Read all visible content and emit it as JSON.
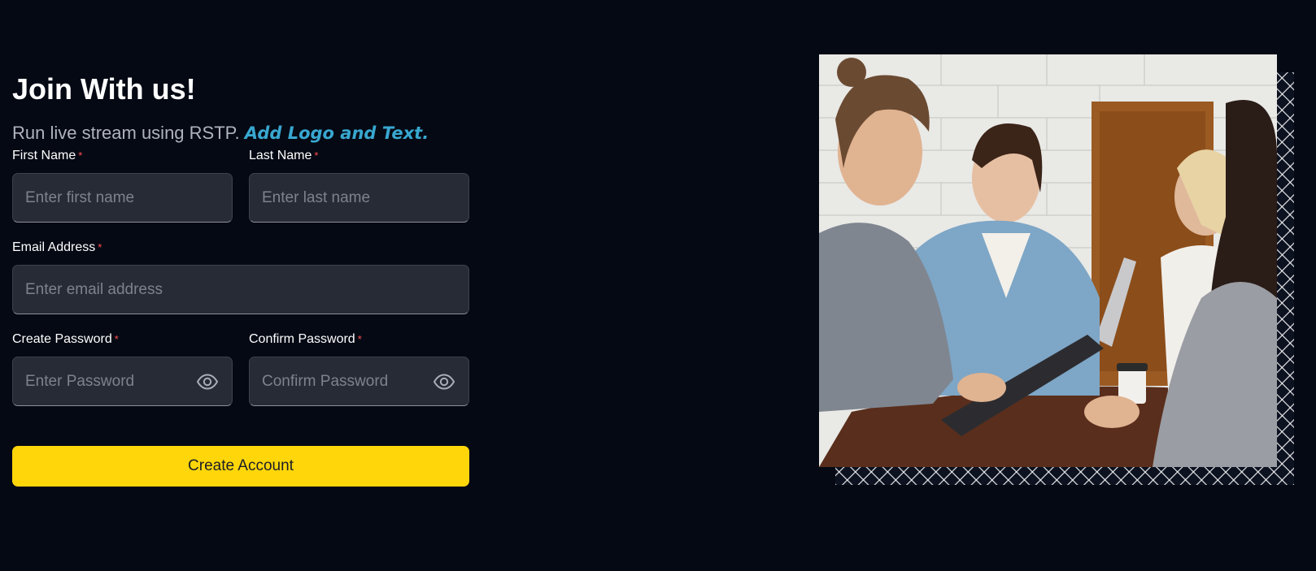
{
  "form": {
    "title": "Join With us!",
    "subtitle": "Run live stream using RSTP.",
    "subtitle_accent": "Add Logo and Text.",
    "required_mark": "*",
    "first_name": {
      "label": "First Name",
      "placeholder": "Enter first name"
    },
    "last_name": {
      "label": "Last Name",
      "placeholder": "Enter last name"
    },
    "email": {
      "label": "Email Address",
      "placeholder": "Enter email address"
    },
    "password": {
      "label": "Create Password",
      "placeholder": "Enter Password",
      "icon": "eye-icon"
    },
    "confirm_password": {
      "label": "Confirm Password",
      "placeholder": "Confirm Password",
      "icon": "eye-icon"
    },
    "submit_label": "Create Account"
  },
  "colors": {
    "background": "#050914",
    "input_bg": "#272b36",
    "accent": "#38a7cf",
    "button": "#ffd60a",
    "required": "#ff4d4f"
  }
}
